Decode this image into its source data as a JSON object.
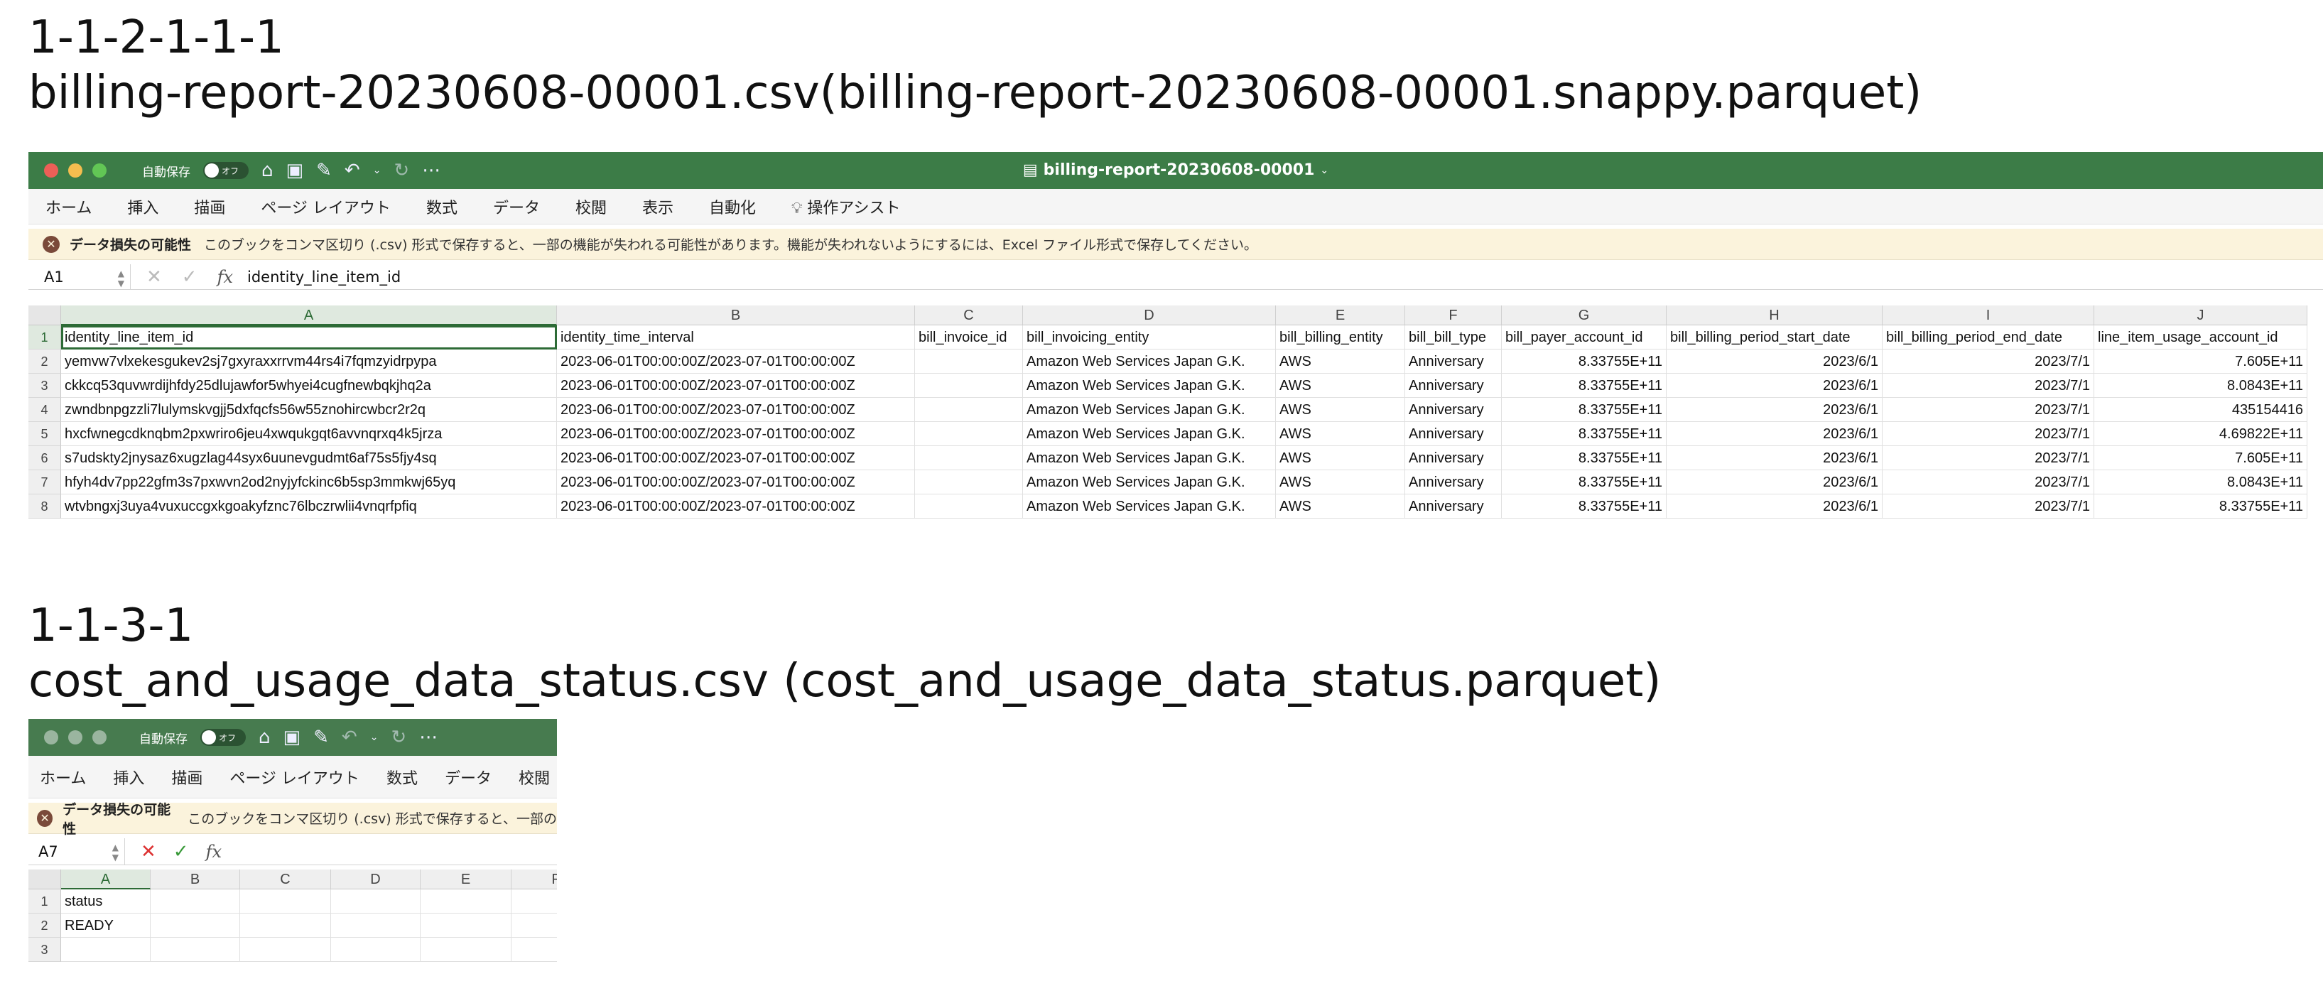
{
  "section1": {
    "number": "1-1-2-1-1-1",
    "filename": "billing-report-20230608-00001.csv(billing-report-20230608-00001.snappy.parquet)"
  },
  "section2": {
    "number": "1-1-3-1",
    "filename": "cost_and_usage_data_status.csv (cost_and_usage_data_status.parquet)"
  },
  "colors": {
    "titlebar": "#3c7c47",
    "light_close": "#ec5f57",
    "light_min": "#f4bd4f",
    "light_max": "#62c655",
    "light_inactive": "#9ab59f",
    "banner_bg": "#fbf3dc",
    "selection": "#2d6b36"
  },
  "window1": {
    "autosave_label": "自動保存",
    "autosave_state": "オフ",
    "doc_title": "billing-report-20230608-00001",
    "ribbon": [
      "ホーム",
      "挿入",
      "描画",
      "ページ レイアウト",
      "数式",
      "データ",
      "校閲",
      "表示",
      "自動化",
      "操作アシスト"
    ],
    "banner_title": "データ損失の可能性",
    "banner_message": "このブックをコンマ区切り (.csv) 形式で保存すると、一部の機能が失われる可能性があります。機能が失われないようにするには、Excel ファイル形式で保存してください。",
    "namebox": "A1",
    "formula": "identity_line_item_id",
    "columns": [
      "A",
      "B",
      "C",
      "D",
      "E",
      "F",
      "G",
      "H",
      "I",
      "J"
    ],
    "row_numbers": [
      "1",
      "2",
      "3",
      "4",
      "5",
      "6",
      "7",
      "8"
    ],
    "rows": [
      [
        "identity_line_item_id",
        "identity_time_interval",
        "bill_invoice_id",
        "bill_invoicing_entity",
        "bill_billing_entity",
        "bill_bill_type",
        "bill_payer_account_id",
        "bill_billing_period_start_date",
        "bill_billing_period_end_date",
        "line_item_usage_account_id"
      ],
      [
        "yemvw7vlxekesgukev2sj7gxyraxxrrvm44rs4i7fqmzyidrpypa",
        "2023-06-01T00:00:00Z/2023-07-01T00:00:00Z",
        "",
        "Amazon Web Services Japan G.K.",
        "AWS",
        "Anniversary",
        "8.33755E+11",
        "2023/6/1",
        "2023/7/1",
        "7.605E+11"
      ],
      [
        "ckkcq53quvwrdijhfdy25dlujawfor5whyei4cugfnewbqkjhq2a",
        "2023-06-01T00:00:00Z/2023-07-01T00:00:00Z",
        "",
        "Amazon Web Services Japan G.K.",
        "AWS",
        "Anniversary",
        "8.33755E+11",
        "2023/6/1",
        "2023/7/1",
        "8.0843E+11"
      ],
      [
        "zwndbnpgzzli7lulymskvgjj5dxfqcfs56w55znohircwbcr2r2q",
        "2023-06-01T00:00:00Z/2023-07-01T00:00:00Z",
        "",
        "Amazon Web Services Japan G.K.",
        "AWS",
        "Anniversary",
        "8.33755E+11",
        "2023/6/1",
        "2023/7/1",
        "435154416"
      ],
      [
        "hxcfwnegcdknqbm2pxwriro6jeu4xwqukgqt6avvnqrxq4k5jrza",
        "2023-06-01T00:00:00Z/2023-07-01T00:00:00Z",
        "",
        "Amazon Web Services Japan G.K.",
        "AWS",
        "Anniversary",
        "8.33755E+11",
        "2023/6/1",
        "2023/7/1",
        "4.69822E+11"
      ],
      [
        "s7udskty2jnysaz6xugzlag44syx6uunevgudmt6af75s5fjy4sq",
        "2023-06-01T00:00:00Z/2023-07-01T00:00:00Z",
        "",
        "Amazon Web Services Japan G.K.",
        "AWS",
        "Anniversary",
        "8.33755E+11",
        "2023/6/1",
        "2023/7/1",
        "7.605E+11"
      ],
      [
        "hfyh4dv7pp22gfm3s7pxwvn2od2nyjyfckinc6b5sp3mmkwj65yq",
        "2023-06-01T00:00:00Z/2023-07-01T00:00:00Z",
        "",
        "Amazon Web Services Japan G.K.",
        "AWS",
        "Anniversary",
        "8.33755E+11",
        "2023/6/1",
        "2023/7/1",
        "8.0843E+11"
      ],
      [
        "wtvbngxj3uya4vuxuccgxkgoakyfznc76lbczrwlii4vnqrfpfiq",
        "2023-06-01T00:00:00Z/2023-07-01T00:00:00Z",
        "",
        "Amazon Web Services Japan G.K.",
        "AWS",
        "Anniversary",
        "8.33755E+11",
        "2023/6/1",
        "2023/7/1",
        "8.33755E+11"
      ]
    ]
  },
  "window2": {
    "autosave_label": "自動保存",
    "autosave_state": "オフ",
    "ribbon": [
      "ホーム",
      "挿入",
      "描画",
      "ページ レイアウト",
      "数式",
      "データ",
      "校閲"
    ],
    "banner_title": "データ損失の可能性",
    "banner_message": "このブックをコンマ区切り (.csv) 形式で保存すると、一部の",
    "namebox": "A7",
    "columns": [
      "A",
      "B",
      "C",
      "D",
      "E",
      "F"
    ],
    "row_numbers": [
      "1",
      "2",
      "3"
    ],
    "rows": [
      [
        "status"
      ],
      [
        "READY"
      ],
      [
        ""
      ]
    ]
  }
}
